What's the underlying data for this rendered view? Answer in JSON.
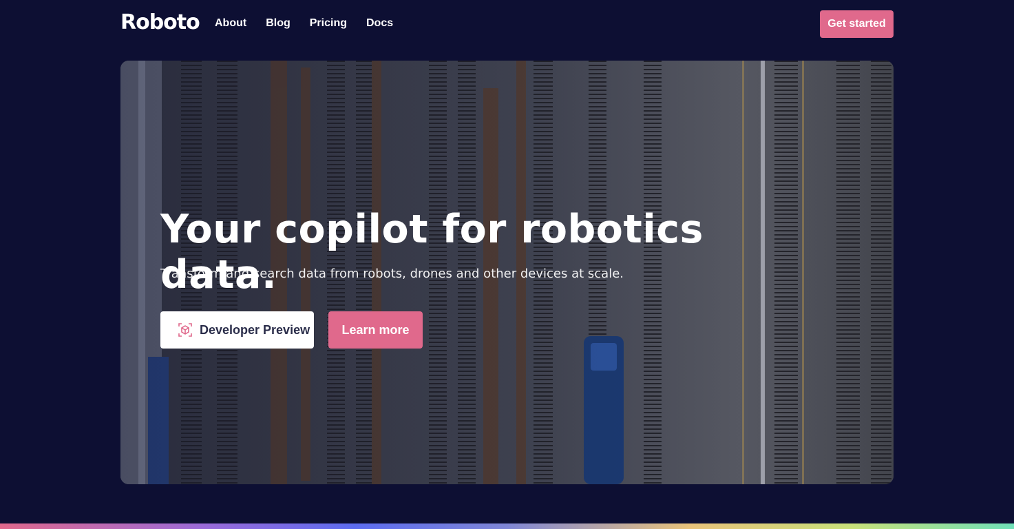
{
  "brand": {
    "logo_text": "Roboto"
  },
  "nav": {
    "links": [
      "About",
      "Blog",
      "Pricing",
      "Docs"
    ],
    "cta_label": "Get started"
  },
  "hero": {
    "headline": "Your copilot for robotics data.",
    "subheadline": "Transform and search data from robots, drones and other devices at scale.",
    "primary_button": {
      "label": "Developer Preview",
      "icon": "cube-scan-icon"
    },
    "secondary_button": {
      "label": "Learn more"
    },
    "background": "aerial-rail-yard-image"
  },
  "colors": {
    "page_background": "#0d0f33",
    "accent": "#e0698c",
    "button_text_dark": "#2a2d4a"
  }
}
